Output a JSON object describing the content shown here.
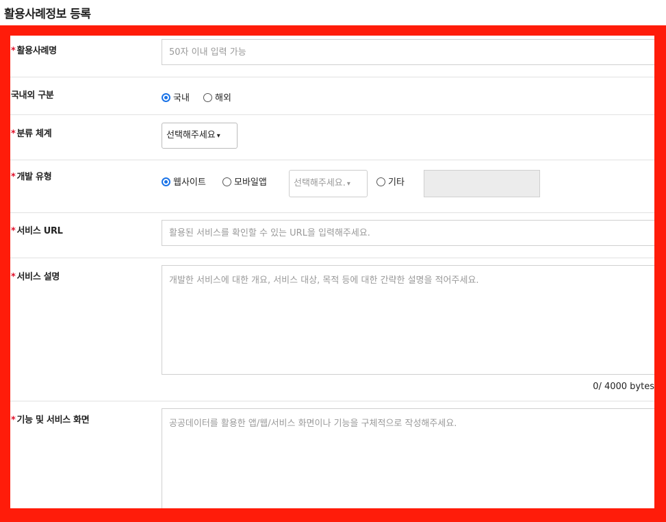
{
  "page": {
    "title": "활용사례정보 등록"
  },
  "required_mark": "*",
  "fields": {
    "name": {
      "label": "활용사례명",
      "placeholder": "50자 이내 입력 가능"
    },
    "region": {
      "label": "국내외 구분",
      "options": [
        "국내",
        "해외"
      ],
      "selected": "국내"
    },
    "category": {
      "label": "분류 체계",
      "select_value": "선택해주세요"
    },
    "dev_type": {
      "label": "개발 유형",
      "options": {
        "web": "웹사이트",
        "mobile": "모바일앱",
        "etc": "기타"
      },
      "selected": "웹사이트",
      "mobile_select": "선택해주세요."
    },
    "url": {
      "label": "서비스 URL",
      "placeholder": "활용된 서비스를 확인할 수 있는 URL을 입력해주세요."
    },
    "desc": {
      "label": "서비스 설명",
      "placeholder": "개발한 서비스에 대한 개요, 서비스 대상, 목적 등에 대한 간략한 설명을 적어주세요.",
      "counter": "0/ 4000 bytes"
    },
    "features": {
      "label": "기능 및 서비스 화면",
      "placeholder": "공공데이터를 활용한 앱/웹/서비스 화면이나 기능을 구체적으로 작성해주세요."
    }
  },
  "colors": {
    "highlight_frame": "#ff1c0a",
    "required": "#e0112b",
    "radio_checked": "#1a73e8"
  }
}
